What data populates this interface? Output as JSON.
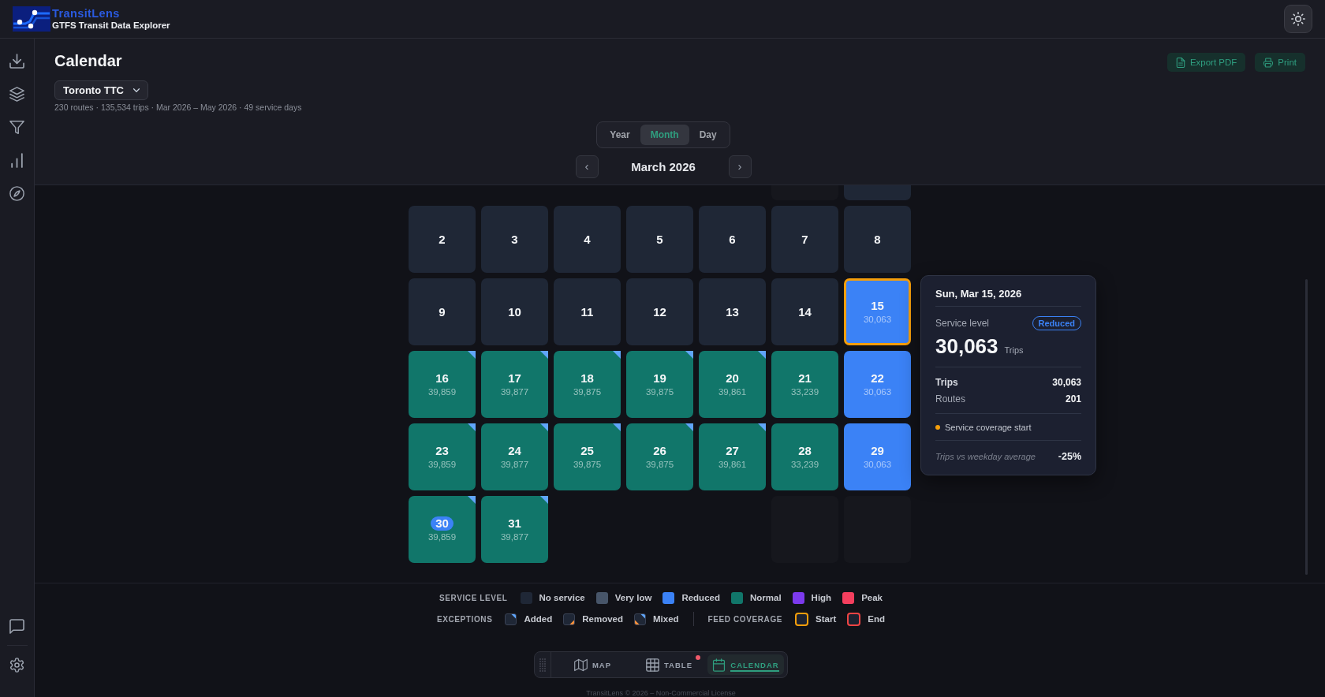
{
  "app": {
    "name": "TransitLens",
    "subtitle": "GTFS Transit Data Explorer"
  },
  "page": {
    "title": "Calendar",
    "actions": [
      {
        "label": "Export PDF"
      },
      {
        "label": "Print"
      }
    ],
    "feed": "Toronto TTC",
    "summary": "230 routes · 135,534 trips · Mar 2026 – May 2026 · 49 service days"
  },
  "views": [
    {
      "label": "Year",
      "selected": false
    },
    {
      "label": "Month",
      "selected": true
    },
    {
      "label": "Day",
      "selected": false
    }
  ],
  "nav": {
    "prev": "‹",
    "month": "March 2026",
    "next": "›"
  },
  "calendar": {
    "weeks": [
      {
        "partial": true,
        "days": [
          {
            "kind": "blank"
          },
          {
            "kind": "blank"
          },
          {
            "kind": "blank"
          },
          {
            "kind": "blank"
          },
          {
            "kind": "blank"
          },
          {
            "kind": "blank"
          },
          {
            "kind": "day",
            "color": "#1f2736"
          }
        ]
      },
      {
        "days": [
          {
            "kind": "day",
            "day": "2",
            "color": "#1f2736"
          },
          {
            "kind": "day",
            "day": "3",
            "color": "#1f2736"
          },
          {
            "kind": "day",
            "day": "4",
            "color": "#1f2736"
          },
          {
            "kind": "day",
            "day": "5",
            "color": "#1f2736"
          },
          {
            "kind": "day",
            "day": "6",
            "color": "#1f2736"
          },
          {
            "kind": "day",
            "day": "7",
            "color": "#1f2736"
          },
          {
            "kind": "day",
            "day": "8",
            "color": "#1f2736"
          }
        ]
      },
      {
        "days": [
          {
            "kind": "day",
            "day": "9",
            "color": "#1f2736"
          },
          {
            "kind": "day",
            "day": "10",
            "color": "#1f2736"
          },
          {
            "kind": "day",
            "day": "11",
            "color": "#1f2736"
          },
          {
            "kind": "day",
            "day": "12",
            "color": "#1f2736"
          },
          {
            "kind": "day",
            "day": "13",
            "color": "#1f2736"
          },
          {
            "kind": "day",
            "day": "14",
            "color": "#1f2736"
          },
          {
            "kind": "day",
            "day": "15",
            "trips": "30,063",
            "color": "#3b82f6",
            "coverage_start": true
          }
        ]
      },
      {
        "days": [
          {
            "kind": "day",
            "day": "16",
            "trips": "39,859",
            "color": "#11766a",
            "added": true
          },
          {
            "kind": "day",
            "day": "17",
            "trips": "39,877",
            "color": "#11766a",
            "added": true
          },
          {
            "kind": "day",
            "day": "18",
            "trips": "39,875",
            "color": "#11766a",
            "added": true
          },
          {
            "kind": "day",
            "day": "19",
            "trips": "39,875",
            "color": "#11766a",
            "added": true
          },
          {
            "kind": "day",
            "day": "20",
            "trips": "39,861",
            "color": "#11766a",
            "added": true
          },
          {
            "kind": "day",
            "day": "21",
            "trips": "33,239",
            "color": "#11766a"
          },
          {
            "kind": "day",
            "day": "22",
            "trips": "30,063",
            "color": "#3b82f6"
          }
        ]
      },
      {
        "days": [
          {
            "kind": "day",
            "day": "23",
            "trips": "39,859",
            "color": "#11766a",
            "added": true
          },
          {
            "kind": "day",
            "day": "24",
            "trips": "39,877",
            "color": "#11766a",
            "added": true
          },
          {
            "kind": "day",
            "day": "25",
            "trips": "39,875",
            "color": "#11766a",
            "added": true
          },
          {
            "kind": "day",
            "day": "26",
            "trips": "39,875",
            "color": "#11766a",
            "added": true
          },
          {
            "kind": "day",
            "day": "27",
            "trips": "39,861",
            "color": "#11766a",
            "added": true
          },
          {
            "kind": "day",
            "day": "28",
            "trips": "33,239",
            "color": "#11766a"
          },
          {
            "kind": "day",
            "day": "29",
            "trips": "30,063",
            "color": "#3b82f6"
          }
        ]
      },
      {
        "days": [
          {
            "kind": "day",
            "day": "30",
            "trips": "39,859",
            "color": "#11766a",
            "added": true,
            "today": true
          },
          {
            "kind": "day",
            "day": "31",
            "trips": "39,877",
            "color": "#11766a",
            "added": true
          },
          {
            "kind": "blank"
          },
          {
            "kind": "blank"
          },
          {
            "kind": "blank"
          },
          {
            "kind": "blank"
          },
          {
            "kind": "blank"
          }
        ]
      }
    ]
  },
  "tooltip": {
    "title": "Sun, Mar 15, 2026",
    "level_label": "Service level",
    "badge": "Reduced",
    "total": "30,063",
    "unit": "Trips",
    "stats": [
      {
        "label": "Trips",
        "value": "30,063",
        "emphasis": true
      },
      {
        "label": "Routes",
        "value": "201",
        "emphasis": false
      }
    ],
    "note": "Service coverage start",
    "comparison": {
      "label": "Trips vs weekday average",
      "value": "-25%"
    }
  },
  "legend": {
    "rows": [
      {
        "groups": [
          {
            "title": "SERVICE LEVEL",
            "items": [
              {
                "kind": "fill",
                "color": "#1f2736",
                "label": "No service"
              },
              {
                "kind": "fill",
                "color": "#475569",
                "label": "Very low"
              },
              {
                "kind": "fill",
                "color": "#3b82f6",
                "label": "Reduced"
              },
              {
                "kind": "fill",
                "color": "#11766a",
                "label": "Normal"
              },
              {
                "kind": "fill",
                "color": "#7c3aed",
                "label": "High"
              },
              {
                "kind": "fill",
                "color": "#f43f5e",
                "label": "Peak"
              }
            ]
          }
        ]
      },
      {
        "groups": [
          {
            "title": "EXCEPTIONS",
            "items": [
              {
                "kind": "added",
                "label": "Added"
              },
              {
                "kind": "removed",
                "label": "Removed"
              },
              {
                "kind": "mixed",
                "label": "Mixed"
              }
            ]
          },
          {
            "title": "FEED COVERAGE",
            "items": [
              {
                "kind": "outline",
                "color": "#f59e0b",
                "label": "Start"
              },
              {
                "kind": "outline",
                "color": "#ef4444",
                "label": "End"
              }
            ]
          }
        ]
      }
    ]
  },
  "dock": [
    {
      "label": "MAP",
      "selected": false,
      "badge": false
    },
    {
      "label": "TABLE",
      "selected": false,
      "badge": true
    },
    {
      "label": "CALENDAR",
      "selected": true,
      "badge": false
    }
  ],
  "footer": "TransitLens © 2026 – Non-Commercial License"
}
